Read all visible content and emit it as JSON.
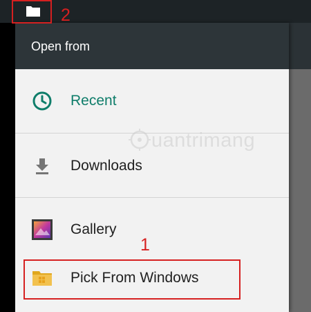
{
  "header": {
    "title": "Open from"
  },
  "drawer": {
    "items": [
      {
        "label": "Recent",
        "icon": "clock-icon"
      },
      {
        "label": "Downloads",
        "icon": "download-icon"
      },
      {
        "label": "Gallery",
        "icon": "gallery-icon"
      },
      {
        "label": "Pick From Windows",
        "icon": "windows-folder-icon"
      }
    ]
  },
  "annotations": {
    "callout_1": "1",
    "callout_2": "2"
  },
  "watermark": {
    "text": "uantrimang"
  },
  "colors": {
    "accent": "#0f7d6a",
    "header": "#2d3539",
    "status_bar": "#1d2326",
    "annotation": "#d62020",
    "drawer_bg": "#f2f2f2"
  }
}
